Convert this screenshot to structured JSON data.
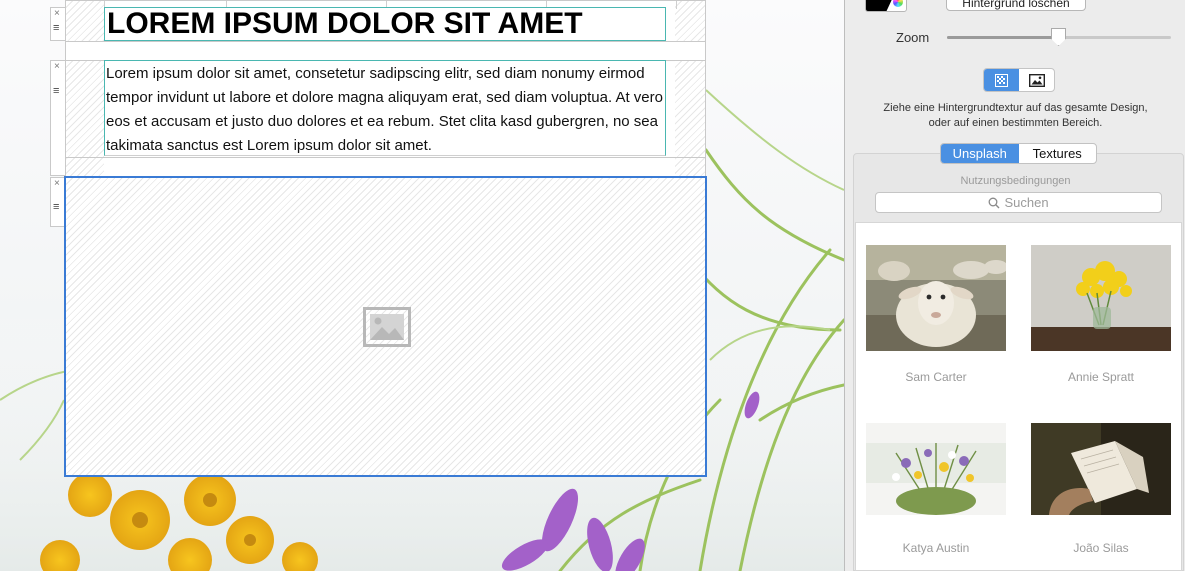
{
  "canvas": {
    "title_text": "LOREM IPSUM DOLOR SIT AMET",
    "body_text": "Lorem ipsum dolor sit amet, consetetur sadipscing elitr, sed diam nonumy eirmod tempor invidunt ut labore et dolore magna aliquyam erat, sed diam voluptua. At vero eos et accusam et justo duo dolores et ea rebum. Stet clita kasd gubergren, no sea takimata sanctus est Lorem ipsum dolor sit amet.",
    "row_remove_glyph": "×",
    "row_handle_glyph": "≡",
    "image_placeholder_icon": "image-placeholder-icon",
    "selection_color": "#3a7bd5",
    "text_frame_color": "#4ab7b1"
  },
  "panel": {
    "clear_background_label": "Hintergrund löschen",
    "zoom_label": "Zoom",
    "zoom_level": 0.5,
    "mode_buttons": [
      {
        "icon": "texture-icon",
        "active": true
      },
      {
        "icon": "photo-icon",
        "active": false
      }
    ],
    "hint_line1": "Ziehe eine Hintergrundtextur auf das gesamte Design,",
    "hint_line2": "oder auf einen bestimmten Bereich.",
    "source_tabs": [
      {
        "label": "Unsplash",
        "active": true
      },
      {
        "label": "Textures",
        "active": false
      }
    ],
    "terms_label": "Nutzungsbedingungen",
    "search_placeholder": "Suchen",
    "images": [
      {
        "credit": "Sam Carter",
        "subject": "sheep"
      },
      {
        "credit": "Annie Spratt",
        "subject": "yellow-flowers-vase"
      },
      {
        "credit": "Katya Austin",
        "subject": "wildflower-bouquet"
      },
      {
        "credit": "João Silas",
        "subject": "open-book"
      }
    ],
    "accent_color": "#4a90e2"
  }
}
